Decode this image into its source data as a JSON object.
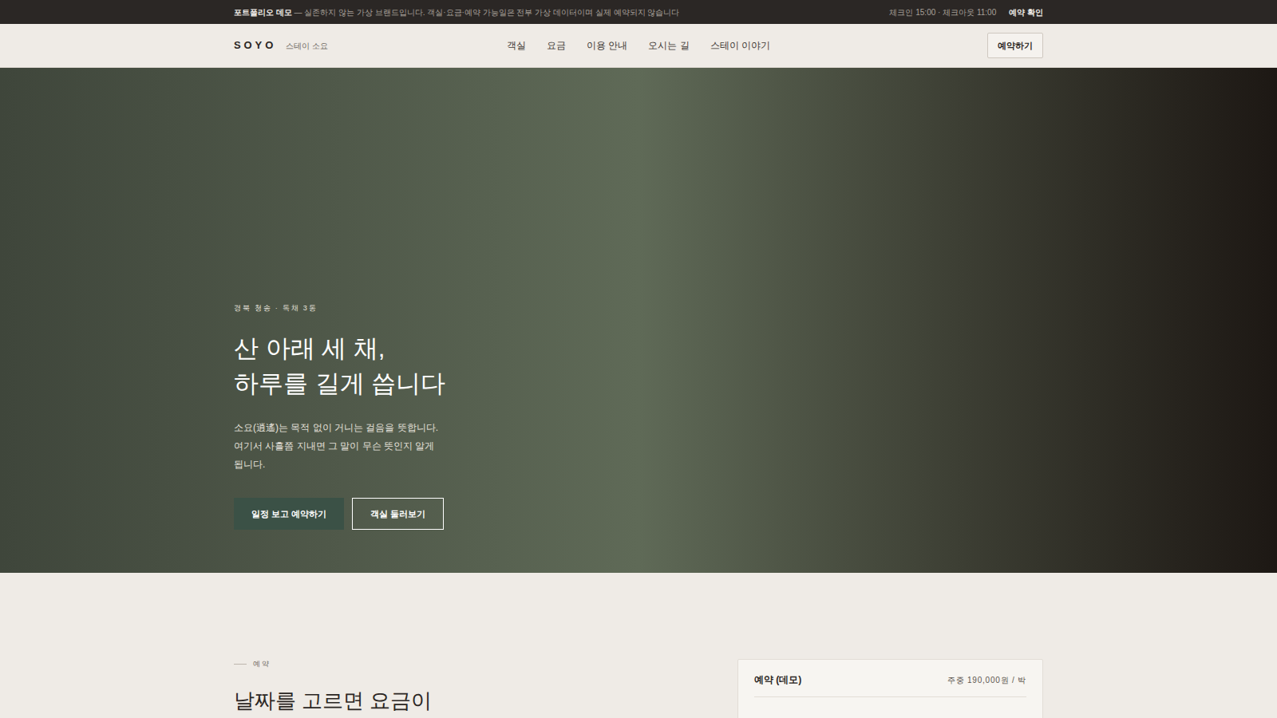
{
  "notice": {
    "title": "포트폴리오 데모",
    "text": "— 실존하지 않는 가상 브랜드입니다. 객실·요금·예약 가능일은 전부 가상 데이터이며 실제 예약되지 않습니다",
    "hours": "체크인 15:00 · 체크아웃 11:00",
    "link": "예약 확인"
  },
  "brand": {
    "logo": "SOYO",
    "name": "스테이 소요"
  },
  "nav": {
    "items": [
      {
        "label": "객실"
      },
      {
        "label": "요금"
      },
      {
        "label": "이용 안내"
      },
      {
        "label": "오시는 길"
      },
      {
        "label": "스테이 이야기"
      }
    ],
    "cta": "예약하기"
  },
  "hero": {
    "eyebrow": "경북 청송 · 독채 3동",
    "title_lines": [
      "산 아래 세 채,",
      "하루를 길게 씁니다"
    ],
    "description_lines": [
      "소요(逍遙)는 목적 없이 거니는 걸음을 뜻합니다.",
      "여기서 사흘쯤 지내면 그 말이 무슨 뜻인지 알게",
      "됩니다."
    ],
    "buttons": [
      {
        "label": "일정 보고 예약하기",
        "kind": "primary"
      },
      {
        "label": "객실 둘러보기",
        "kind": "outline"
      }
    ]
  },
  "booking": {
    "label": "예약",
    "title": "날짜를 고르면 요금이",
    "card": {
      "title": "예약 (데모)",
      "price": "주중 190,000원 / 박"
    }
  }
}
